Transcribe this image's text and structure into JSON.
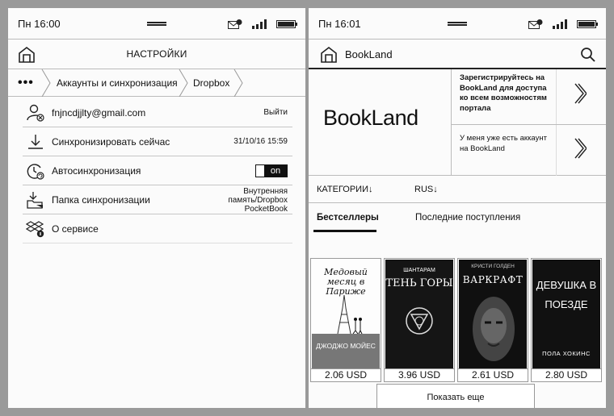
{
  "settings_screen": {
    "status": {
      "time": "Пн 16:00",
      "mail_count": "8"
    },
    "header": {
      "title": "НАСТРОЙКИ"
    },
    "breadcrumb": {
      "more": "•••",
      "items": [
        "Аккаунты и синхронизация",
        "Dropbox"
      ]
    },
    "rows": [
      {
        "label": "fnjncdjjlty@gmail.com",
        "action": "Выйти"
      },
      {
        "label": "Синхронизировать сейчас",
        "value": "31/10/16 15:59"
      },
      {
        "label": "Автосинхронизация",
        "toggle": "on"
      },
      {
        "label": "Папка синхронизации",
        "value_lines": [
          "Внутренняя",
          "память/Dropbox",
          "PocketBook"
        ]
      },
      {
        "label": "О сервисе"
      }
    ]
  },
  "store_screen": {
    "status": {
      "time": "Пн 16:01",
      "mail_count": "8"
    },
    "header": {
      "title": "BookLand"
    },
    "banner": {
      "logo": "BookLand",
      "promo_register": "Зарегистрируйтесь на BookLand для доступа ко всем возможностям портала",
      "promo_login": "У меня уже есть аккаунт на BookLand"
    },
    "filters": {
      "categories": "КАТЕГОРИИ↓",
      "language": "RUS↓"
    },
    "tabs": {
      "active": "Бестселлеры",
      "other": "Последние поступления"
    },
    "books": [
      {
        "cover_title": "Медовый месяц в Париже",
        "cover_author": "ДЖОДЖО МОЙЕС",
        "price": "2.06 USD"
      },
      {
        "cover_title": "ТЕНЬ ГОРЫ",
        "cover_author": "ШАНТАРАМ",
        "price": "3.96 USD"
      },
      {
        "cover_title": "ВАРКРАФТ",
        "cover_author": "КРИСТИ ГОЛДЕН",
        "price": "2.61 USD"
      },
      {
        "cover_title": "ДЕВУШКА В ПОЕЗДЕ",
        "cover_author": "ПОЛА ХОКИНС",
        "price": "2.80 USD"
      }
    ],
    "show_more": "Показать еще"
  }
}
